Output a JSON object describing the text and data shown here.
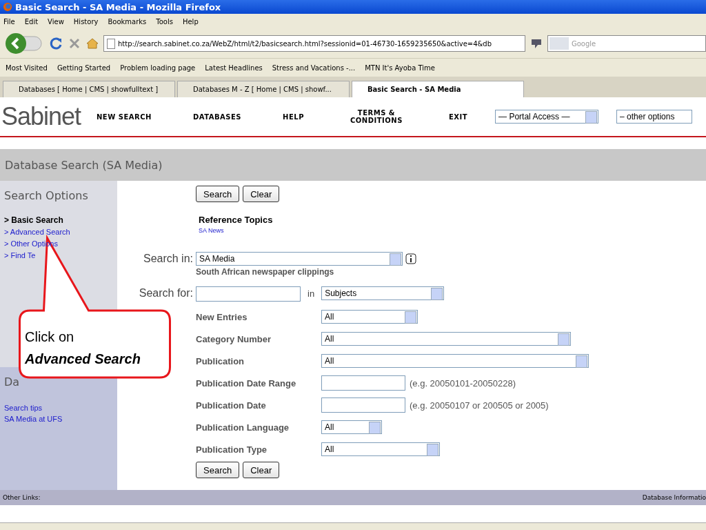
{
  "window": {
    "title": "Basic Search - SA Media - Mozilla Firefox"
  },
  "menu": [
    "File",
    "Edit",
    "View",
    "History",
    "Bookmarks",
    "Tools",
    "Help"
  ],
  "address": {
    "value": "http://search.sabinet.co.za/WebZ/html/t2/basicsearch.html?sessionid=01-46730-1659235650&active=4&db"
  },
  "search_box": {
    "placeholder": "Google"
  },
  "bookmarks": [
    "Most Visited",
    "Getting Started",
    "Problem loading page",
    "Latest Headlines",
    "Stress and Vacations -...",
    "MTN It's Ayoba Time"
  ],
  "tabs": [
    {
      "label": "Databases [ Home | CMS | showfulltext ]",
      "selected": false
    },
    {
      "label": "Databases M - Z [ Home | CMS | showf...",
      "selected": false
    },
    {
      "label": "Basic Search - SA Media",
      "selected": true
    }
  ],
  "site": {
    "logo": "Sabinet",
    "nav": [
      "NEW SEARCH",
      "DATABASES",
      "HELP",
      "TERMS & CONDITIONS",
      "EXIT"
    ],
    "portal": "— Portal Access —",
    "other": "– other options"
  },
  "page_title": "Database Search (SA Media)",
  "sidebar": {
    "heading": "Search Options",
    "items": [
      {
        "label": "> Basic Search",
        "selected": true
      },
      {
        "label": "> Advanced Search",
        "selected": false
      },
      {
        "label": "> Other Options",
        "selected": false
      },
      {
        "label": "> Find Te",
        "selected": false
      }
    ],
    "links_heading": "Da",
    "links": [
      "Search tips",
      "SA Media at UFS"
    ]
  },
  "form": {
    "buttons_top": [
      "Search",
      "Clear"
    ],
    "buttons_bottom": [
      "Search",
      "Clear"
    ],
    "ref_heading": "Reference Topics",
    "ref_link": "SA News",
    "search_in": {
      "label": "Search in:",
      "value": "SA Media",
      "note": "South African newspaper clippings"
    },
    "search_for": {
      "label": "Search for:",
      "in": "in",
      "field": "Subjects"
    },
    "rows": [
      {
        "label": "New Entries",
        "kind": "select",
        "value": "All"
      },
      {
        "label": "Category Number",
        "kind": "select",
        "value": "All"
      },
      {
        "label": "Publication",
        "kind": "select",
        "value": "All"
      },
      {
        "label": "Publication Date Range",
        "kind": "text",
        "hint": "(e.g. 20050101-20050228)"
      },
      {
        "label": "Publication Date",
        "kind": "text",
        "hint": "(e.g. 20050107 or 200505 or 2005)"
      },
      {
        "label": "Publication Language",
        "kind": "select",
        "value": "All"
      },
      {
        "label": "Publication Type",
        "kind": "select",
        "value": "All"
      }
    ]
  },
  "footer": {
    "left": "Other Links:",
    "right": "Database Informatio"
  },
  "callout": {
    "line1": "Click on",
    "line2": "Advanced Search"
  }
}
